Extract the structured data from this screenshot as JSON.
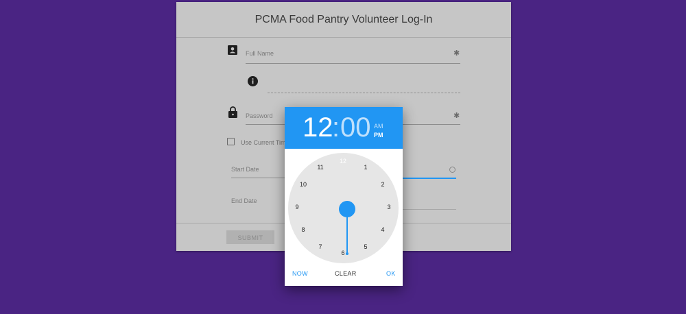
{
  "form": {
    "title": "PCMA Food Pantry Volunteer Log-In",
    "full_name_label": "Full Name",
    "password_label": "Password",
    "required_mark": "✱",
    "use_current_time_label": "Use Current Tim",
    "start_date_label": "Start Date",
    "end_date_label": "End Date",
    "submit_label": "SUBMIT",
    "icons": {
      "name": "contact-card-icon",
      "info": "info-icon",
      "password": "lock-icon"
    }
  },
  "time_picker": {
    "hours": "12",
    "colon": ":",
    "minutes": "00",
    "am": "AM",
    "pm": "PM",
    "selected_period": "PM",
    "selected_hour": "12",
    "dial_numbers": [
      "12",
      "1",
      "2",
      "3",
      "4",
      "5",
      "6",
      "7",
      "8",
      "9",
      "10",
      "11"
    ],
    "now_label": "NOW",
    "clear_label": "CLEAR",
    "ok_label": "OK"
  },
  "colors": {
    "background": "#4a2483",
    "accent": "#2196f3",
    "card_dimmed": "#c6c6c6"
  }
}
